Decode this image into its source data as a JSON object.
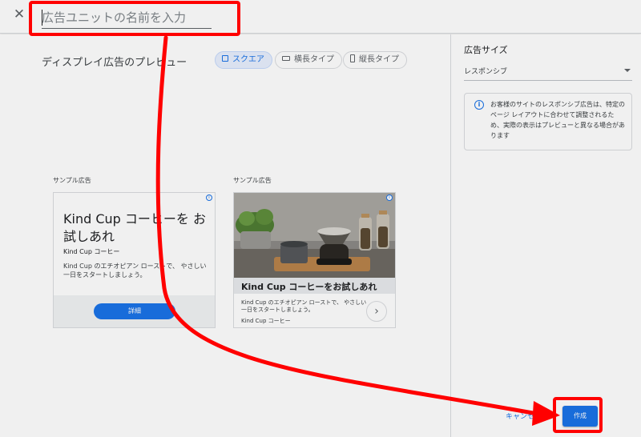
{
  "header": {
    "close_icon": "close-icon",
    "name_placeholder": "広告ユニットの名前を入力"
  },
  "preview": {
    "title": "ディスプレイ広告のプレビュー",
    "shapes": [
      {
        "label": "スクエア",
        "icon": "square-icon",
        "active": true
      },
      {
        "label": "横長タイプ",
        "icon": "landscape-icon",
        "active": false
      },
      {
        "label": "縦長タイプ",
        "icon": "portrait-icon",
        "active": false
      }
    ],
    "samples": [
      {
        "label": "サンプル広告",
        "headline": "Kind Cup コーヒーを お試しあれ",
        "advertiser": "Kind Cup コーヒー",
        "description": "Kind Cup のエチオピアン ローストで、 やさしい一日をスタートしましょう。",
        "cta": "詳細"
      },
      {
        "label": "サンプル広告",
        "headline": "Kind Cup コーヒーをお試しあれ",
        "description": "Kind Cup のエチオピアン ローストで、 やさしい一日をスタートしましょう。",
        "advertiser": "Kind Cup コーヒー"
      }
    ]
  },
  "side": {
    "size_label": "広告サイズ",
    "size_value": "レスポンシブ",
    "info_text": "お客様のサイトのレスポンシブ広告は、特定のページ レイアウトに合わせて調整されるため、実際の表示はプレビューと異なる場合があります",
    "cancel_label": "キャンセル",
    "create_label": "作成"
  },
  "colors": {
    "accent": "#1a73e8",
    "annotation": "#ff0000"
  }
}
